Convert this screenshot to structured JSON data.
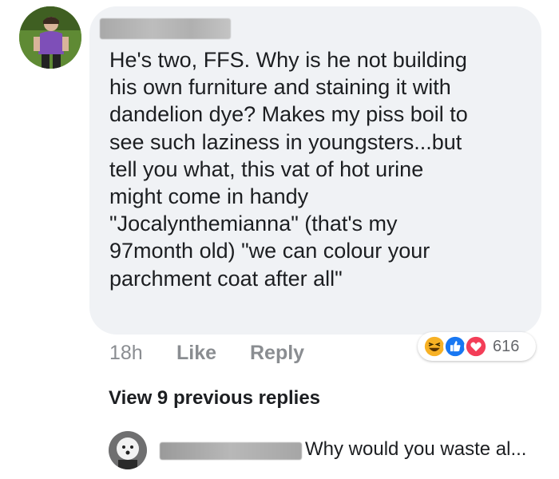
{
  "comment": {
    "text": "He's two, FFS. Why is he not building\nhis own furniture and staining it with\ndandelion dye? Makes my piss boil to\nsee such laziness in youngsters...but\ntell you what, this vat of hot urine\nmight come in handy\n\"Jocalynthemianna\" (that's my\n97month old) \"we can colour your\nparchment coat after all\"",
    "time": "18h",
    "like_label": "Like",
    "reply_label": "Reply",
    "reaction_count": "616",
    "reaction_icons": [
      "haha-icon",
      "like-icon",
      "love-icon"
    ]
  },
  "thread": {
    "view_previous": "View 9 previous replies"
  },
  "reply": {
    "snippet": "Why would you waste al..."
  },
  "colors": {
    "bubble": "#f0f2f5",
    "like_blue": "#1877f2",
    "love_red": "#f33e58",
    "haha_yellow": "#f7b125"
  }
}
